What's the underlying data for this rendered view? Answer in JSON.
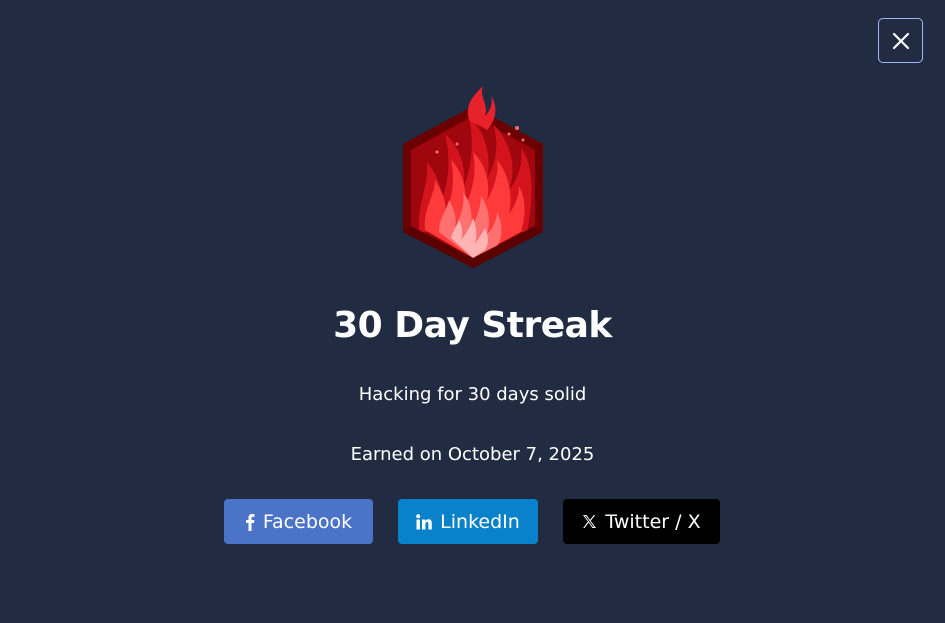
{
  "close": {
    "icon": "close-icon"
  },
  "badge": {
    "icon": "flame-hexagon-icon",
    "colors": {
      "dark": "#6b0000",
      "mid": "#c4101a",
      "bright": "#ff3b3b",
      "light": "#ffb0b0"
    }
  },
  "achievement": {
    "title": "30 Day Streak",
    "description": "Hacking for 30 days solid",
    "earned": "Earned on October 7, 2025"
  },
  "share": {
    "facebook": {
      "label": "Facebook",
      "icon": "facebook-icon",
      "color": "#4b73c8"
    },
    "linkedin": {
      "label": "LinkedIn",
      "icon": "linkedin-icon",
      "color": "#0a82cb"
    },
    "twitter": {
      "label": "Twitter / X",
      "icon": "x-icon",
      "color": "#000000"
    }
  },
  "colors": {
    "background": "#212c42",
    "text": "#ffffff",
    "close_border": "#9cb7f3"
  }
}
